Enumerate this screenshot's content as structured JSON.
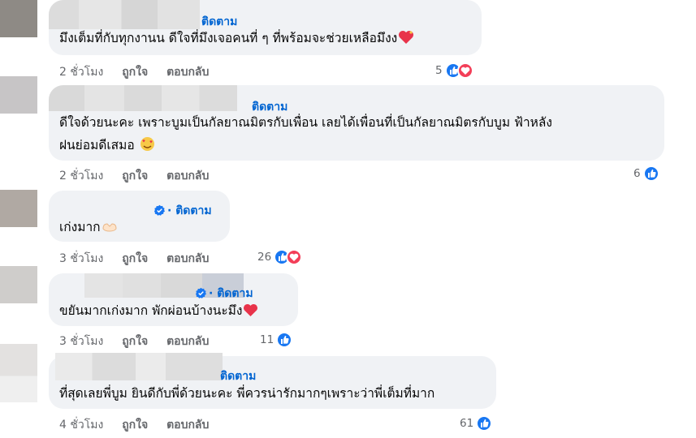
{
  "comments": [
    {
      "follow": "ติดตาม",
      "text": "มึงเต็มที่กับทุกงานน ดีใจที่มึงเจอคนที่ ๆ ที่พร้อมจะช่วยเหลือมึงง",
      "time": "2 ชั่วโมง",
      "like": "ถูกใจ",
      "reply": "ตอบกลับ",
      "reactions": "5",
      "reaction_icons": [
        "like-icon",
        "heart-icon"
      ],
      "emoji": "heart-sparkle-icon"
    },
    {
      "follow": "ติดตาม",
      "text_line1": "ดีใจด้วยนะคะ เพราะบูมเป็นกัลยาณมิตรกับเพื่อน เลยได้เพื่อนที่เป็นกัลยาณมิตรกับบูม ฟ้าหลัง",
      "text_line2": "ฝนย่อมดีเสมอ",
      "time": "2 ชั่วโมง",
      "like": "ถูกใจ",
      "reply": "ตอบกลับ",
      "reactions": "6",
      "reaction_icons": [
        "like-icon"
      ],
      "emoji": "smiling-hearts-icon"
    },
    {
      "follow": "· ติดตาม",
      "text": "เก่งมาก",
      "time": "3 ชั่วโมง",
      "like": "ถูกใจ",
      "reply": "ตอบกลับ",
      "reactions": "26",
      "reaction_icons": [
        "like-icon",
        "heart-icon"
      ],
      "emoji": "heart-hands-icon",
      "verified": true
    },
    {
      "follow": "· ติดตาม",
      "text": "ขยันมากเก่งมาก พักผ่อนบ้างนะมึง",
      "time": "3 ชั่วโมง",
      "like": "ถูกใจ",
      "reply": "ตอบกลับ",
      "reactions": "11",
      "reaction_icons": [
        "like-icon"
      ],
      "emoji": "red-heart-icon",
      "verified": true
    },
    {
      "follow": "ติดตาม",
      "text": "ที่สุดเลยพี่บูม ยินดีกับพี่ด้วยนะคะ พี่ควรน่ารักมากๆเพราะว่าพี่เต็มที่มาก",
      "time": "4 ชั่วโมง",
      "like": "ถูกใจ",
      "reply": "ตอบกลับ",
      "reactions": "61",
      "reaction_icons": [
        "like-icon"
      ]
    }
  ],
  "colors": {
    "bubble": "#f0f2f5",
    "follow": "#0064d1",
    "like_reaction": "#1877f2",
    "heart_reaction": "#f33e58",
    "meta_text": "#65676b"
  }
}
